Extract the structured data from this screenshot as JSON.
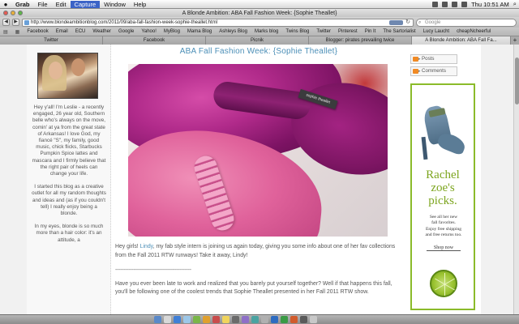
{
  "menubar": {
    "apple": "",
    "items": [
      "Grab",
      "File",
      "Edit",
      "Capture",
      "Window",
      "Help"
    ],
    "clock": "Thu 10:51 AM"
  },
  "window": {
    "title": "A Blonde Ambition: ABA Fall Fashion Week: {Sophie Theallet}"
  },
  "toolbar": {
    "back": "◀",
    "forward": "▶",
    "url": "http://www.blondeambitionblog.com/2011/09/aba-fall-fashion-week-sophie-theallet.html",
    "reload": "↻",
    "search_placeholder": "Google"
  },
  "bookmarks": [
    "Facebook",
    "Email",
    "ECU",
    "Weather",
    "Google",
    "Yahoo!",
    "MyBlog",
    "Mama Blog",
    "Ashleys Blog",
    "Marks blog",
    "Twins Blog",
    "Twitter",
    "Pinterest",
    "Pin It",
    "The Sartorialist",
    "Lucy Laucht",
    "cheapNcheerful"
  ],
  "tabs": [
    {
      "label": "Twitter"
    },
    {
      "label": "Facebook"
    },
    {
      "label": "Picnik"
    },
    {
      "label": "Blogger: pirates prevailing twice"
    },
    {
      "label": "A Blonde Ambition: ABA Fall Fa..."
    }
  ],
  "sidebar": {
    "bio": [
      "Hey y'all! I'm Leslie - a recently engaged, 26 year old, Southern belle who's always on the move, comin' at ya from the great state of Arkansas! I love God, my fiancé \"S\", my family, good music, chick flicks, Starbucks Pumpkin Spice lattes and mascara and I firmly believe that the right pair of heels can change your life.",
      "I started this blog as a creative outlet for all my random thoughts and ideas and (as if you couldn't tell) I really enjoy being a blonde.",
      "In my eyes, blonde is so much more than a hair color: it's an attitude, a"
    ]
  },
  "post": {
    "title": "ABA Fall Fashion Week: {Sophie Theallet}",
    "image_label": "sophie theallet",
    "intro_start": "Hey girls! ",
    "intro_link": "Lindy",
    "intro_rest": ", my fab style intern is joining us again today, giving you some info about one of her fav collections from the Fall 2011 RTW runways! Take it away, Lindy!",
    "separator": "-----------------------------------------------",
    "paragraph2": "Have you ever been late to work and realized that you barely put yourself together? Well if that happens this fall, you'll be following one of the coolest trends that Sophie Theallet presented in her Fall 2011 RTW show."
  },
  "rightbar": {
    "feed_posts": "Posts",
    "feed_comments": "Comments",
    "ad": {
      "brand_line1": "Rachel",
      "brand_line2": "zoe's",
      "brand_line3": "picks.",
      "promo_line1": "See all her new",
      "promo_line2": "fall favorites.",
      "promo_line3": "Enjoy free shipping",
      "promo_line4": "and free returns too.",
      "cta": "Shop now"
    }
  },
  "colors": {
    "accent": "#4c8fb7",
    "ad_green": "#8bbb2a",
    "silk_magenta": "#b02a8a",
    "silk_pink": "#e0629b"
  }
}
